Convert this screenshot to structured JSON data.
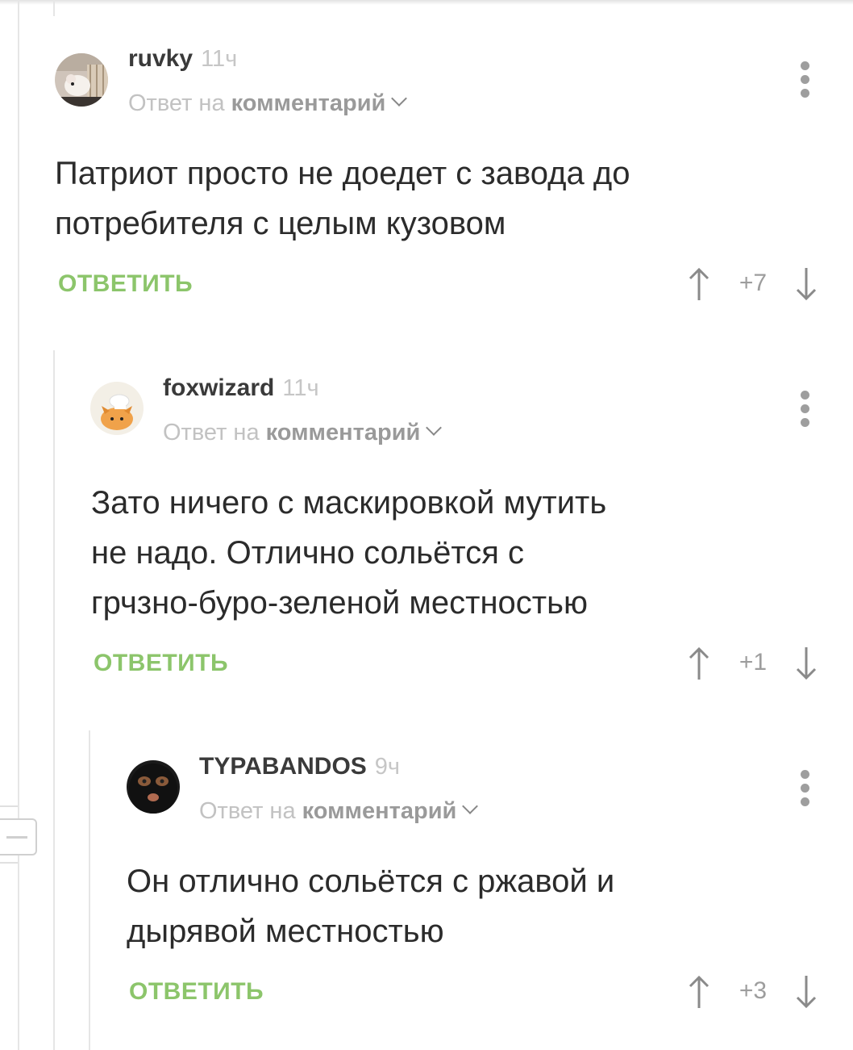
{
  "comments": [
    {
      "author": "ruvky",
      "time": "11ч",
      "reply_prefix": "Ответ на",
      "reply_link": "комментарий",
      "text_lines": [
        "Патриот просто не доедет с завода до",
        "потребителя с целым кузовом"
      ],
      "reply_label": "ОТВЕТИТЬ",
      "score": "+7",
      "avatar": "rat-photo-avatar"
    },
    {
      "author": "foxwizard",
      "time": "11ч",
      "reply_prefix": "Ответ на",
      "reply_link": "комментарий",
      "text_lines": [
        "Зато ничего с маскировкой мутить",
        "не надо. Отлично сольётся с",
        "грчзно-буро-зеленой местностью"
      ],
      "reply_label": "ОТВЕТИТЬ",
      "score": "+1",
      "avatar": "fox-wizard-avatar"
    },
    {
      "author": "TYPABANDOS",
      "time": "9ч",
      "reply_prefix": "Ответ на",
      "reply_link": "комментарий",
      "text_lines": [
        "Он отлично сольётся с ржавой и",
        "дырявой местностью"
      ],
      "reply_label": "ОТВЕТИТЬ",
      "score": "+3",
      "avatar": "balaclava-avatar"
    }
  ],
  "colors": {
    "reply_green": "#8cc56b",
    "muted_gray": "#c2c2c2",
    "text": "#2b2b2b"
  }
}
